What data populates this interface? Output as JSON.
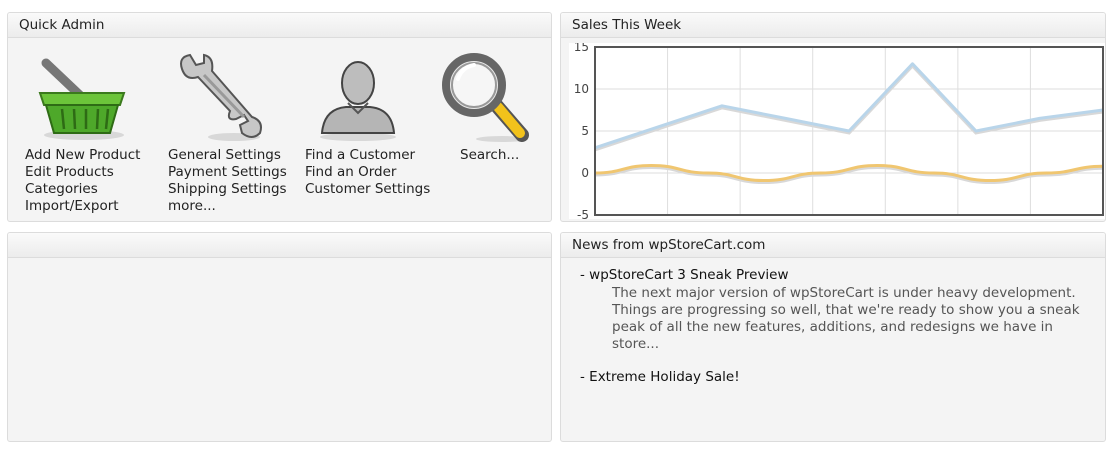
{
  "quick_admin": {
    "title": "Quick Admin",
    "columns": [
      {
        "icon": "basket-icon",
        "links": [
          "Add New Product",
          "Edit Products",
          "Categories",
          "Import/Export"
        ]
      },
      {
        "icon": "wrench-icon",
        "links": [
          "General Settings",
          "Payment Settings",
          "Shipping Settings",
          "more..."
        ]
      },
      {
        "icon": "customer-icon",
        "links": [
          "Find a Customer",
          "Find an Order",
          "Customer Settings"
        ]
      },
      {
        "icon": "magnifier-icon",
        "links": [
          "Search..."
        ]
      }
    ]
  },
  "sales": {
    "title": "Sales This Week"
  },
  "chart_data": {
    "type": "line",
    "title": "Sales This Week",
    "x": [
      0,
      1,
      2,
      3,
      4,
      5,
      6,
      7
    ],
    "ylim": [
      -5,
      15
    ],
    "yticks": [
      15,
      10,
      5,
      0,
      -5
    ],
    "grid": true,
    "series": [
      {
        "color": "#b9d5ea",
        "values": [
          3,
          5.5,
          8,
          6.5,
          5,
          13,
          5,
          6.5,
          7.5
        ]
      },
      {
        "color": "#f0c670",
        "values": [
          0,
          0.9,
          0,
          -0.9,
          0,
          0.9,
          0,
          -0.9,
          0,
          0.8
        ]
      }
    ]
  },
  "news": {
    "title": "News from wpStoreCart.com",
    "items": [
      {
        "title": "- wpStoreCart 3 Sneak Preview",
        "summary": "The next major version of wpStoreCart is under heavy development.  Things are progressing so well, that we're ready to show you a sneak peak of all the new features, additions, and redesigns we have in store..."
      },
      {
        "title": "- Extreme Holiday Sale!",
        "summary": ""
      }
    ]
  },
  "colors": {
    "panel_bg": "#f4f4f4",
    "panel_border": "#dcdcdc",
    "chart_border": "#555555",
    "series_blue": "#b9d5ea",
    "series_gold": "#f0c670"
  }
}
